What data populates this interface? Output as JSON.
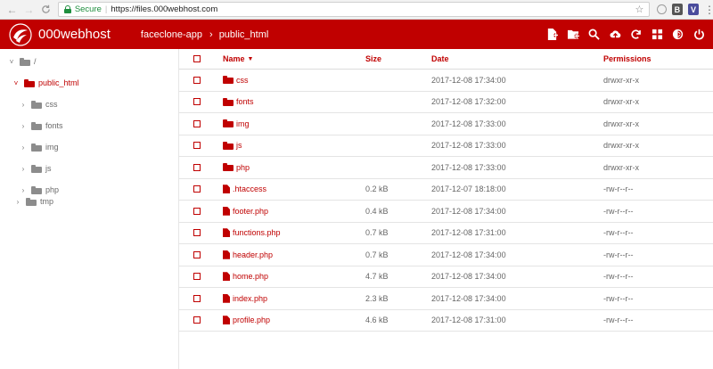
{
  "browser": {
    "secure_label": "Secure",
    "separator": "|",
    "url": "https://files.000webhost.com",
    "back_glyph": "←",
    "forward_glyph": "→",
    "reload_glyph": "C",
    "star_glyph": "☆",
    "extensions": [
      {
        "name": "shield-icon",
        "glyph": ""
      },
      {
        "name": "b-extension-icon",
        "glyph": "B"
      },
      {
        "name": "v-extension-icon",
        "glyph": "V"
      }
    ],
    "menu_glyph": "⋮"
  },
  "header": {
    "brand": "000webhost",
    "breadcrumbs": [
      "faceclone-app",
      "public_html"
    ],
    "crumb_separator": "›",
    "accent_color": "#c00000",
    "tools": [
      "new-file-icon",
      "new-folder-icon",
      "search-icon",
      "upload-icon",
      "refresh-icon",
      "grid-view-icon",
      "settings-icon",
      "power-icon"
    ]
  },
  "sidebar": {
    "items": [
      {
        "label": "/",
        "chevron": "˅",
        "depth": 0,
        "active": false,
        "open": true
      },
      {
        "label": "public_html",
        "chevron": "˅",
        "depth": 1,
        "active": true,
        "open": true
      },
      {
        "label": "css",
        "chevron": "›",
        "depth": 2,
        "active": false
      },
      {
        "label": "fonts",
        "chevron": "›",
        "depth": 2,
        "active": false
      },
      {
        "label": "img",
        "chevron": "›",
        "depth": 2,
        "active": false
      },
      {
        "label": "js",
        "chevron": "›",
        "depth": 2,
        "active": false
      },
      {
        "label": "php",
        "chevron": "›",
        "depth": 2,
        "active": false
      },
      {
        "label": "tmp",
        "chevron": "›",
        "depth": 1,
        "active": false
      }
    ]
  },
  "table": {
    "headers": {
      "name": "Name",
      "sort_arrow": "▼",
      "size": "Size",
      "date": "Date",
      "permissions": "Permissions"
    },
    "rows": [
      {
        "type": "folder",
        "name": "css",
        "size": "",
        "date": "2017-12-08 17:34:00",
        "permissions": "drwxr-xr-x"
      },
      {
        "type": "folder",
        "name": "fonts",
        "size": "",
        "date": "2017-12-08 17:32:00",
        "permissions": "drwxr-xr-x"
      },
      {
        "type": "folder",
        "name": "img",
        "size": "",
        "date": "2017-12-08 17:33:00",
        "permissions": "drwxr-xr-x"
      },
      {
        "type": "folder",
        "name": "js",
        "size": "",
        "date": "2017-12-08 17:33:00",
        "permissions": "drwxr-xr-x"
      },
      {
        "type": "folder",
        "name": "php",
        "size": "",
        "date": "2017-12-08 17:33:00",
        "permissions": "drwxr-xr-x"
      },
      {
        "type": "file",
        "name": ".htaccess",
        "size": "0.2 kB",
        "date": "2017-12-07 18:18:00",
        "permissions": "-rw-r--r--"
      },
      {
        "type": "file",
        "name": "footer.php",
        "size": "0.4 kB",
        "date": "2017-12-08 17:34:00",
        "permissions": "-rw-r--r--"
      },
      {
        "type": "file",
        "name": "functions.php",
        "size": "0.7 kB",
        "date": "2017-12-08 17:31:00",
        "permissions": "-rw-r--r--"
      },
      {
        "type": "file",
        "name": "header.php",
        "size": "0.7 kB",
        "date": "2017-12-08 17:34:00",
        "permissions": "-rw-r--r--"
      },
      {
        "type": "file",
        "name": "home.php",
        "size": "4.7 kB",
        "date": "2017-12-08 17:34:00",
        "permissions": "-rw-r--r--"
      },
      {
        "type": "file",
        "name": "index.php",
        "size": "2.3 kB",
        "date": "2017-12-08 17:34:00",
        "permissions": "-rw-r--r--"
      },
      {
        "type": "file",
        "name": "profile.php",
        "size": "4.6 kB",
        "date": "2017-12-08 17:31:00",
        "permissions": "-rw-r--r--"
      }
    ]
  }
}
